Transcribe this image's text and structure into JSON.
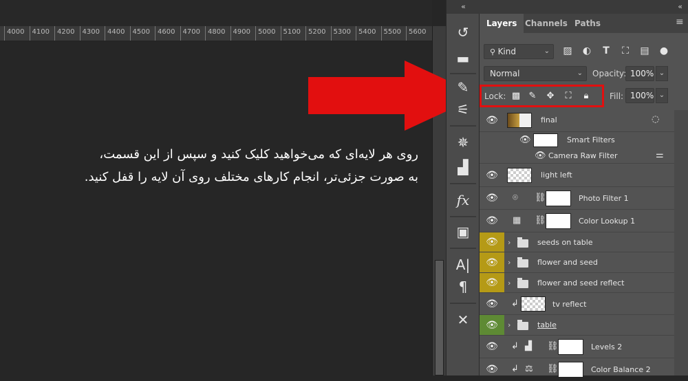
{
  "ruler": {
    "ticks": [
      "4000",
      "4100",
      "4200",
      "4300",
      "4400",
      "4500",
      "4600",
      "4700",
      "4800",
      "4900",
      "5000",
      "5100",
      "5200",
      "5300",
      "5400",
      "5500",
      "5600"
    ]
  },
  "caption": {
    "line1": "روی هر لایه‌ای که می‌خواهید کلیک کنید و سپس از این قسمت،",
    "line2": "به صورت جزئی‌تر، انجام کارهای مختلف روی آن لایه را قفل کنید."
  },
  "annotation": {
    "arrow_color": "#e20f0f"
  },
  "iconstrip": {
    "collapse": "«",
    "icons": [
      "history-icon",
      "comment-icon",
      "brush-settings-icon",
      "adjustments-icon",
      "navigator-wheel-icon",
      "histogram-icon",
      "fx-styles-icon",
      "image-icon",
      "character-icon",
      "paragraph-icon",
      "tools-icon"
    ]
  },
  "panel": {
    "collapse": "«",
    "tabs": [
      "Layers",
      "Channels",
      "Paths"
    ],
    "filter": {
      "label": "Kind"
    },
    "blend_mode": "Normal",
    "opacity_label": "Opacity:",
    "opacity_value": "100%",
    "lock_label": "Lock:",
    "fill_label": "Fill:",
    "fill_value": "100%"
  },
  "layers": [
    {
      "name": "final",
      "type": "smart"
    },
    {
      "name": "Smart Filters",
      "type": "filter-group"
    },
    {
      "name": "Camera Raw Filter",
      "type": "filter"
    },
    {
      "name": "light left",
      "type": "pixel"
    },
    {
      "name": "Photo Filter 1",
      "type": "adjustment"
    },
    {
      "name": "Color Lookup 1",
      "type": "adjustment"
    },
    {
      "name": "seeds on table",
      "type": "group"
    },
    {
      "name": "flower and seed",
      "type": "group"
    },
    {
      "name": "flower and seed reflect",
      "type": "group"
    },
    {
      "name": "tv reflect",
      "type": "pixel"
    },
    {
      "name": "table",
      "type": "group"
    },
    {
      "name": "Levels 2",
      "type": "adjustment"
    },
    {
      "name": "Color Balance 2",
      "type": "adjustment"
    }
  ]
}
